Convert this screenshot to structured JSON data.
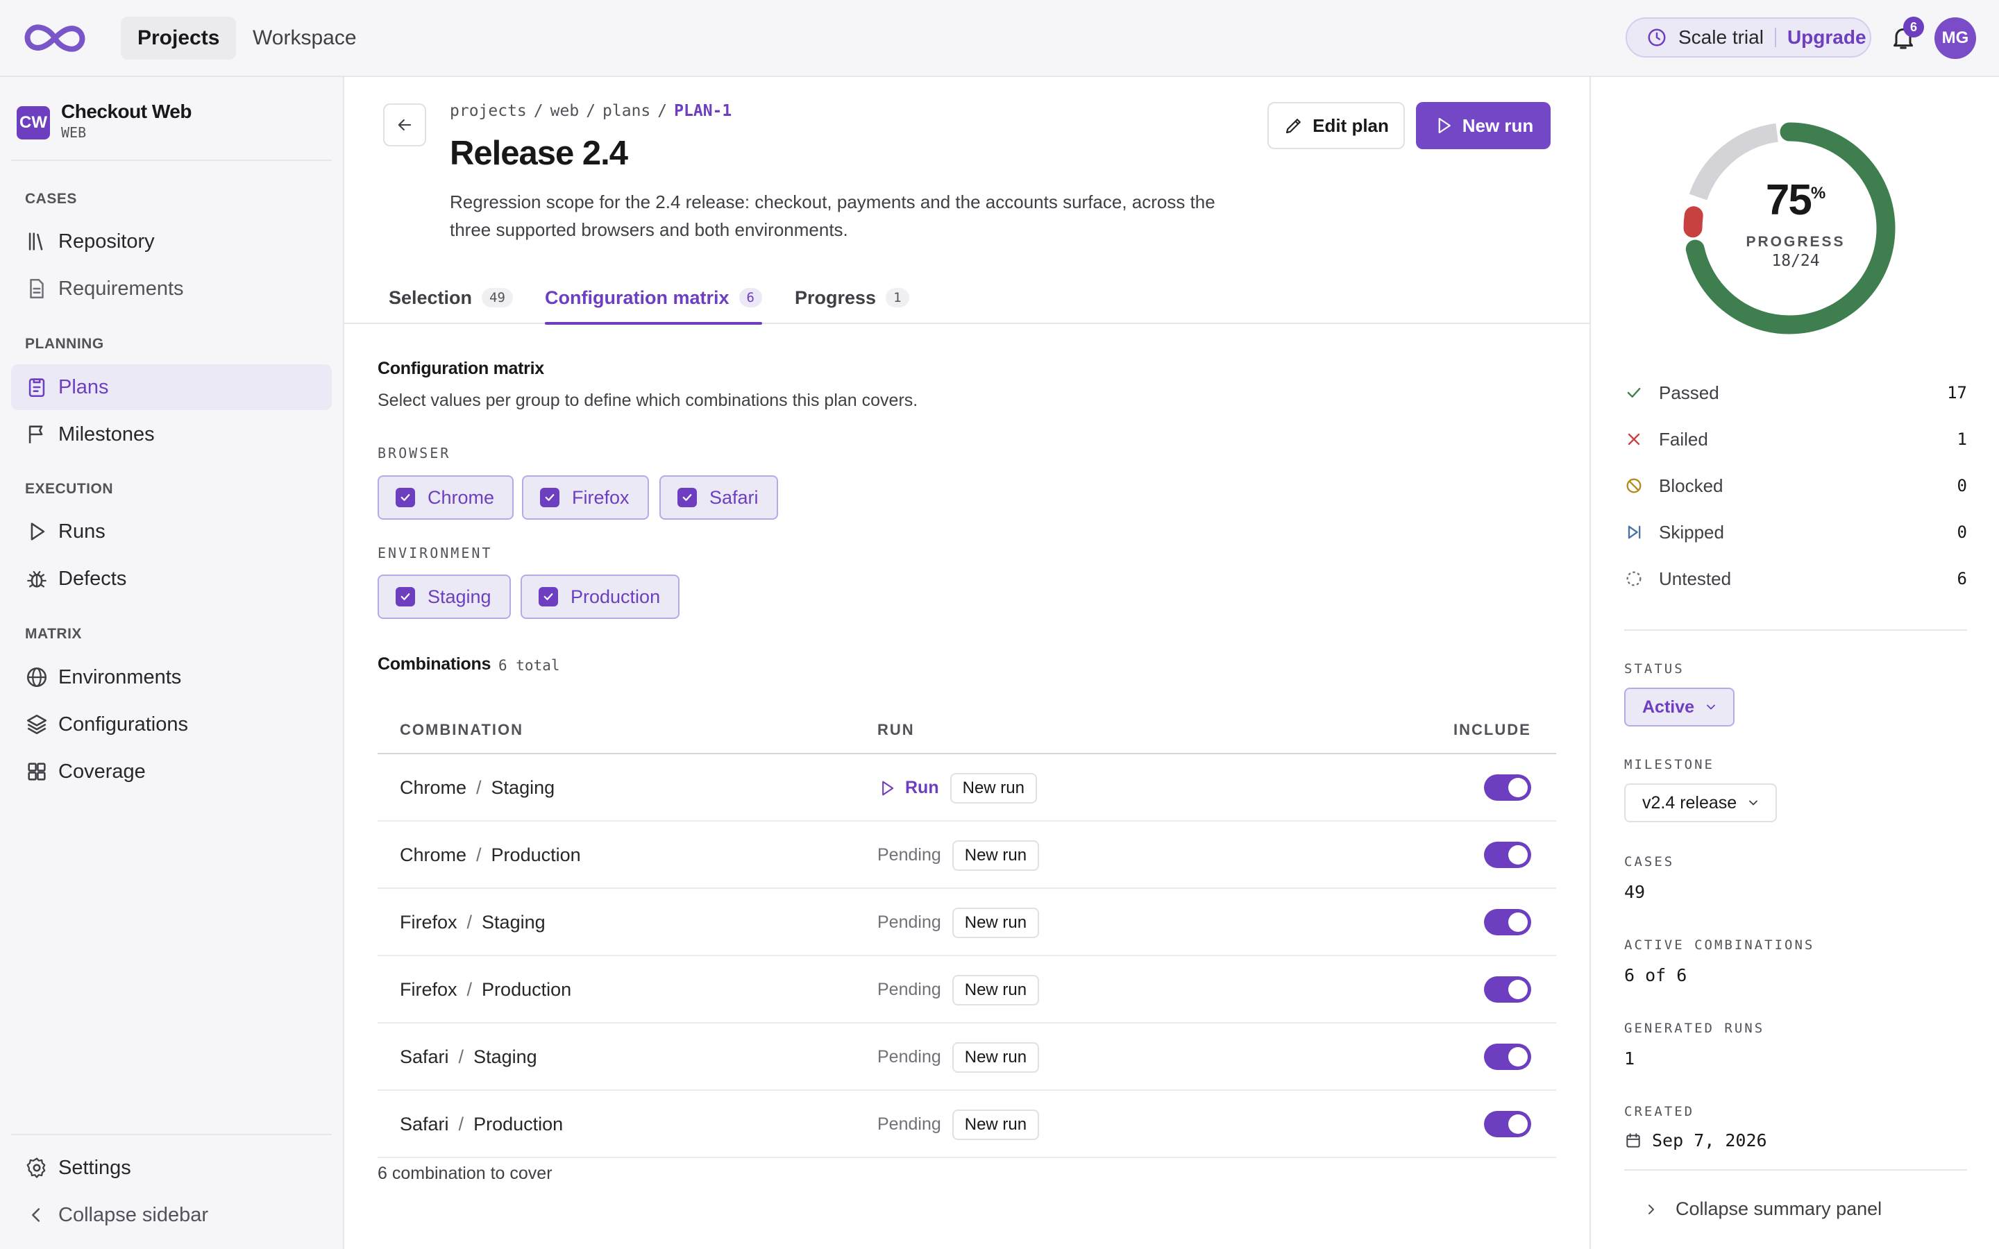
{
  "topbar": {
    "tabs": [
      "Projects",
      "Workspace"
    ],
    "trial_label": "Scale trial",
    "upgrade_label": "Upgrade",
    "notification_count": "6",
    "avatar_initials": "MG"
  },
  "sidebar": {
    "project_initials": "CW",
    "project_name": "Checkout Web",
    "project_key": "WEB",
    "sections": {
      "cases": "CASES",
      "planning": "PLANNING",
      "execution": "EXECUTION",
      "matrix": "MATRIX"
    },
    "items": {
      "repository": "Repository",
      "requirements": "Requirements",
      "plans": "Plans",
      "milestones": "Milestones",
      "runs": "Runs",
      "defects": "Defects",
      "environments": "Environments",
      "configurations": "Configurations",
      "coverage": "Coverage",
      "settings": "Settings",
      "collapse": "Collapse sidebar"
    }
  },
  "header": {
    "breadcrumb": [
      "projects",
      "web",
      "plans",
      "PLAN-1"
    ],
    "title": "Release 2.4",
    "description": "Regression scope for the 2.4 release: checkout, payments and the accounts surface, across the three supported browsers and both environments.",
    "edit_label": "Edit plan",
    "new_run_label": "New run"
  },
  "tabs": [
    {
      "label": "Selection",
      "count": "49"
    },
    {
      "label": "Configuration matrix",
      "count": "6"
    },
    {
      "label": "Progress",
      "count": "1"
    }
  ],
  "matrix": {
    "title": "Configuration matrix",
    "description": "Select values per group to define which combinations this plan covers.",
    "browser_label": "BROWSER",
    "browsers": [
      "Chrome",
      "Firefox",
      "Safari"
    ],
    "environment_label": "ENVIRONMENT",
    "environments": [
      "Staging",
      "Production"
    ],
    "combinations_title": "Combinations",
    "combinations_count": "6 total",
    "columns": [
      "COMBINATION",
      "RUN",
      "INCLUDE"
    ],
    "rows": [
      {
        "a": "Chrome",
        "b": "Staging",
        "run": "Run",
        "pending": "",
        "action": "New run"
      },
      {
        "a": "Chrome",
        "b": "Production",
        "run": "",
        "pending": "Pending",
        "action": "New run"
      },
      {
        "a": "Firefox",
        "b": "Staging",
        "run": "",
        "pending": "Pending",
        "action": "New run"
      },
      {
        "a": "Firefox",
        "b": "Production",
        "run": "",
        "pending": "Pending",
        "action": "New run"
      },
      {
        "a": "Safari",
        "b": "Staging",
        "run": "",
        "pending": "Pending",
        "action": "New run"
      },
      {
        "a": "Safari",
        "b": "Production",
        "run": "",
        "pending": "Pending",
        "action": "New run"
      }
    ],
    "footer": "6 combination to cover"
  },
  "summary": {
    "progress_value": "75",
    "progress_unit": "%",
    "progress_label": "PROGRESS",
    "progress_ratio": "18/24",
    "progress_fraction": 0.75,
    "failed_fraction": 0.0417,
    "stats": [
      {
        "label": "Passed",
        "value": "17"
      },
      {
        "label": "Failed",
        "value": "1"
      },
      {
        "label": "Blocked",
        "value": "0"
      },
      {
        "label": "Skipped",
        "value": "0"
      },
      {
        "label": "Untested",
        "value": "6"
      }
    ],
    "status_label": "STATUS",
    "status_value": "Active",
    "milestone_label": "MILESTONE",
    "milestone_value": "v2.4 release",
    "cases_label": "CASES",
    "cases_value": "49",
    "active_combinations_label": "ACTIVE COMBINATIONS",
    "active_combinations_value": "6 of 6",
    "generated_runs_label": "GENERATED RUNS",
    "generated_runs_value": "1",
    "created_label": "CREATED",
    "created_value": "Sep 7, 2026",
    "collapse_label": "Collapse summary panel"
  },
  "colors": {
    "accent": "#6d3fc0",
    "passed": "#3f7f4f",
    "failed": "#c94040",
    "blocked": "#b58a1a",
    "untested_track": "#d4d4d8"
  }
}
